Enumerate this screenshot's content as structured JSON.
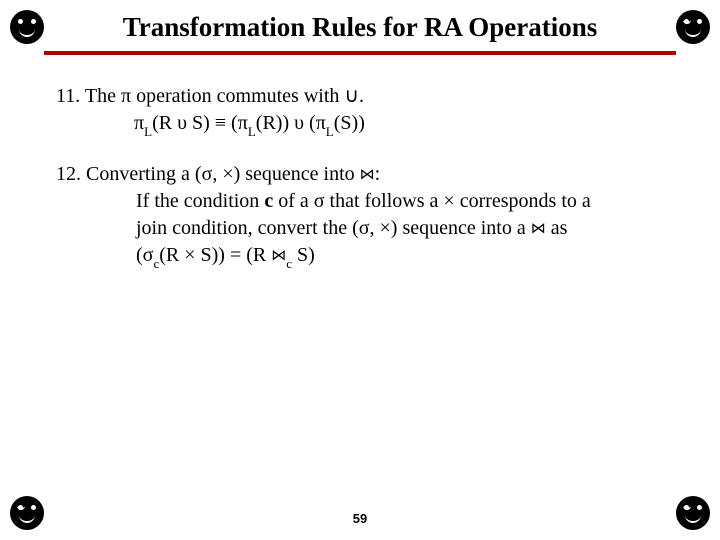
{
  "corners": {
    "glyph": ""
  },
  "title": "Transformation Rules for RA Operations",
  "rule11": {
    "num": "11.",
    "text_a": "The ",
    "pi": "π",
    "text_b": " operation commutes with ",
    "union": "∪",
    "dot": ".",
    "eq_pi1": "π",
    "eq_sub": "L",
    "eq_open1": "(R ",
    "eq_u1": "υ",
    "eq_s1": " S) ",
    "eq_equiv": "≡",
    "eq_open2": " (",
    "eq_pi2": "π",
    "eq_r": "(R)) ",
    "eq_u2": "υ",
    "eq_open3": " (",
    "eq_pi3": "π",
    "eq_s2": "(S))"
  },
  "rule12": {
    "num": "12.",
    "text_a": "Converting a (",
    "sigma": "σ",
    "comma": ", ",
    "times": "×",
    "text_b": ") sequence into ",
    "join": "⋈",
    "colon": ":",
    "line2a": "If the condition ",
    "c": "c",
    "line2b": " of a ",
    "line2c": " that follows a ",
    "line2d": " corresponds to a",
    "line3a": "join condition, convert the (",
    "line3b": ") sequence into a ",
    "line3c": " as",
    "eq_open": "(",
    "eq_sigma": "σ",
    "eq_c": "c",
    "eq_r": "(R ",
    "eq_times": "×",
    "eq_s": " S)) = (R ",
    "eq_join": "⋈",
    "eq_s2": " S)"
  },
  "pageno": "59"
}
